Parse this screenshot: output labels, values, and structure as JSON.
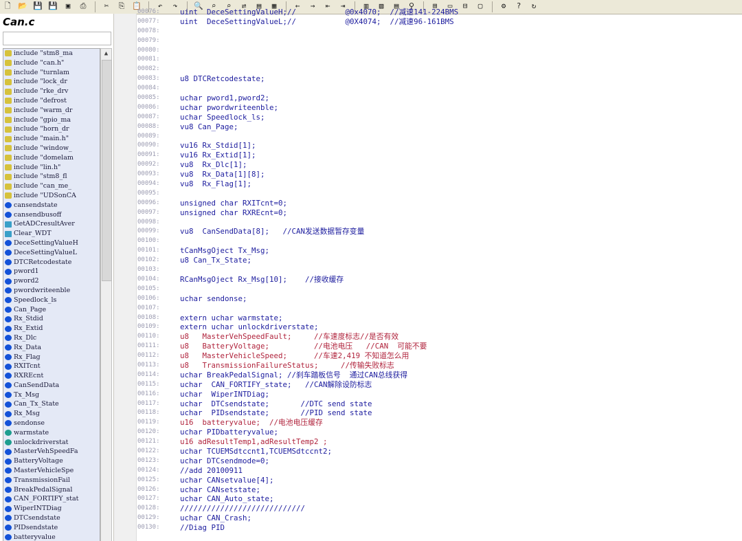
{
  "window": {
    "file_title": "Can.c"
  },
  "toolbar": {
    "buttons": [
      {
        "name": "new-file-icon",
        "glyph": "🗋"
      },
      {
        "name": "open-folder-icon",
        "glyph": "📂"
      },
      {
        "name": "save-icon",
        "glyph": "💾"
      },
      {
        "name": "save-all-icon",
        "glyph": "💾"
      },
      {
        "name": "save-copy-icon",
        "glyph": "▣"
      },
      {
        "name": "print-icon",
        "glyph": "⎙"
      },
      {
        "name": "cut-icon",
        "glyph": "✂"
      },
      {
        "name": "copy-icon",
        "glyph": "⎘"
      },
      {
        "name": "paste-icon",
        "glyph": "📋"
      },
      {
        "name": "undo-icon",
        "glyph": "↶"
      },
      {
        "name": "redo-icon",
        "glyph": "↷"
      },
      {
        "name": "find-icon",
        "glyph": "🔍"
      },
      {
        "name": "find-next-icon",
        "glyph": "⌕"
      },
      {
        "name": "find-prev-icon",
        "glyph": "⌕"
      },
      {
        "name": "replace-icon",
        "glyph": "⇄"
      },
      {
        "name": "bookmark-icon",
        "glyph": "▤"
      },
      {
        "name": "bookmark-clear-icon",
        "glyph": "▦"
      },
      {
        "name": "back-arrow-icon",
        "glyph": "←"
      },
      {
        "name": "forward-arrow-icon",
        "glyph": "→"
      },
      {
        "name": "jump-back-icon",
        "glyph": "⇤"
      },
      {
        "name": "jump-forward-icon",
        "glyph": "⇥"
      },
      {
        "name": "symbol-window-icon",
        "glyph": "▥"
      },
      {
        "name": "relation-window-icon",
        "glyph": "▧"
      },
      {
        "name": "panel-icon",
        "glyph": "▤"
      },
      {
        "name": "lookup-icon",
        "glyph": "⚲"
      },
      {
        "name": "layout-grid-icon",
        "glyph": "⊞"
      },
      {
        "name": "layout-single-icon",
        "glyph": "▭"
      },
      {
        "name": "layout-split-icon",
        "glyph": "⊟"
      },
      {
        "name": "layout-window-icon",
        "glyph": "▢"
      },
      {
        "name": "settings-icon",
        "glyph": "⚙"
      },
      {
        "name": "help-icon",
        "glyph": "?"
      },
      {
        "name": "refresh-icon",
        "glyph": "↻"
      }
    ]
  },
  "symbols": [
    {
      "type": "include",
      "label": "include \"stm8_ma"
    },
    {
      "type": "include",
      "label": "include \"can.h\""
    },
    {
      "type": "include",
      "label": "include \"turnlam"
    },
    {
      "type": "include",
      "label": "include \"lock_dr"
    },
    {
      "type": "include",
      "label": "include \"rke_drv"
    },
    {
      "type": "include",
      "label": "include \"defrost"
    },
    {
      "type": "include",
      "label": "include \"warm_dr"
    },
    {
      "type": "include",
      "label": "include \"gpio_ma"
    },
    {
      "type": "include",
      "label": "include \"horn_dr"
    },
    {
      "type": "include",
      "label": "include \"main.h\""
    },
    {
      "type": "include",
      "label": "include \"window_"
    },
    {
      "type": "include",
      "label": "include \"domelam"
    },
    {
      "type": "include",
      "label": "include \"lin.h\""
    },
    {
      "type": "include",
      "label": "include \"stm8_fl"
    },
    {
      "type": "include",
      "label": "include \"can_me_"
    },
    {
      "type": "include",
      "label": "include \"UDSonCA"
    },
    {
      "type": "var",
      "label": "cansendstate"
    },
    {
      "type": "var",
      "label": "cansendbusoff"
    },
    {
      "type": "func",
      "label": "GetADCresultAver"
    },
    {
      "type": "func",
      "label": "Clear_WDT"
    },
    {
      "type": "var",
      "label": "DeceSettingValueH"
    },
    {
      "type": "var",
      "label": "DeceSettingValueL"
    },
    {
      "type": "var",
      "label": "DTCRetcodestate"
    },
    {
      "type": "var",
      "label": "pword1"
    },
    {
      "type": "var",
      "label": "pword2"
    },
    {
      "type": "var",
      "label": "pwordwriteenble"
    },
    {
      "type": "var",
      "label": "Speedlock_ls"
    },
    {
      "type": "var",
      "label": "Can_Page"
    },
    {
      "type": "var",
      "label": "Rx_Stdid"
    },
    {
      "type": "var",
      "label": "Rx_Extid"
    },
    {
      "type": "var",
      "label": "Rx_Dlc"
    },
    {
      "type": "var",
      "label": "Rx_Data"
    },
    {
      "type": "var",
      "label": "Rx_Flag"
    },
    {
      "type": "var",
      "label": "RXITcnt"
    },
    {
      "type": "var",
      "label": "RXREcnt"
    },
    {
      "type": "var",
      "label": "CanSendData"
    },
    {
      "type": "var",
      "label": "Tx_Msg"
    },
    {
      "type": "var",
      "label": "Can_Tx_State"
    },
    {
      "type": "var",
      "label": "Rx_Msg"
    },
    {
      "type": "var",
      "label": "sendonse"
    },
    {
      "type": "ext",
      "label": "warmstate"
    },
    {
      "type": "ext",
      "label": "unlockdriverstat"
    },
    {
      "type": "var",
      "label": "MasterVehSpeedFa"
    },
    {
      "type": "var",
      "label": "BatteryVoltage"
    },
    {
      "type": "var",
      "label": "MasterVehicleSpe"
    },
    {
      "type": "var",
      "label": "TransmissionFail"
    },
    {
      "type": "var",
      "label": "BreakPedalSignal"
    },
    {
      "type": "var",
      "label": "CAN_FORTIFY_stat"
    },
    {
      "type": "var",
      "label": "WiperINTDiag"
    },
    {
      "type": "var",
      "label": "DTCsendstate"
    },
    {
      "type": "var",
      "label": "PIDsendstate"
    },
    {
      "type": "var",
      "label": "batteryvalue"
    }
  ],
  "code_lines": [
    {
      "num": "00076:",
      "text": "uint  DeceSettingValueH;//           @0x4070;  //减速141-224BMS",
      "style": "normal"
    },
    {
      "num": "00077:",
      "text": "uint  DeceSettingValueL;//           @0X4074;  //减速96-161BMS",
      "style": "normal"
    },
    {
      "num": "00078:",
      "text": "",
      "style": "normal"
    },
    {
      "num": "00079:",
      "text": "",
      "style": "normal"
    },
    {
      "num": "00080:",
      "text": "",
      "style": "normal"
    },
    {
      "num": "00081:",
      "text": "",
      "style": "normal"
    },
    {
      "num": "00082:",
      "text": "",
      "style": "normal"
    },
    {
      "num": "00083:",
      "text": "u8 DTCRetcodestate;",
      "style": "normal"
    },
    {
      "num": "00084:",
      "text": "",
      "style": "normal"
    },
    {
      "num": "00085:",
      "text": "uchar pword1,pword2;",
      "style": "normal"
    },
    {
      "num": "00086:",
      "text": "uchar pwordwriteenble;",
      "style": "normal"
    },
    {
      "num": "00087:",
      "text": "uchar Speedlock_ls;",
      "style": "normal"
    },
    {
      "num": "00088:",
      "text": "vu8 Can_Page;",
      "style": "normal"
    },
    {
      "num": "00089:",
      "text": "",
      "style": "normal"
    },
    {
      "num": "00090:",
      "text": "vu16 Rx_Stdid[1];",
      "style": "normal"
    },
    {
      "num": "00091:",
      "text": "vu16 Rx_Extid[1];",
      "style": "normal"
    },
    {
      "num": "00092:",
      "text": "vu8  Rx_Dlc[1];",
      "style": "normal"
    },
    {
      "num": "00093:",
      "text": "vu8  Rx_Data[1][8];",
      "style": "normal"
    },
    {
      "num": "00094:",
      "text": "vu8  Rx_Flag[1];",
      "style": "normal"
    },
    {
      "num": "00095:",
      "text": "",
      "style": "normal"
    },
    {
      "num": "00096:",
      "text": "unsigned char RXITcnt=0;",
      "style": "normal"
    },
    {
      "num": "00097:",
      "text": "unsigned char RXREcnt=0;",
      "style": "normal"
    },
    {
      "num": "00098:",
      "text": "",
      "style": "normal"
    },
    {
      "num": "00099:",
      "text": "vu8  CanSendData[8];   //CAN发送数据暂存变量",
      "style": "normal"
    },
    {
      "num": "00100:",
      "text": "",
      "style": "normal"
    },
    {
      "num": "00101:",
      "text": "tCanMsgOject Tx_Msg;",
      "style": "normal"
    },
    {
      "num": "00102:",
      "text": "u8 Can_Tx_State;",
      "style": "normal"
    },
    {
      "num": "00103:",
      "text": "",
      "style": "normal"
    },
    {
      "num": "00104:",
      "text": "RCanMsgOject Rx_Msg[10];    //接收缓存",
      "style": "normal"
    },
    {
      "num": "00105:",
      "text": "",
      "style": "normal"
    },
    {
      "num": "00106:",
      "text": "uchar sendonse;",
      "style": "normal"
    },
    {
      "num": "00107:",
      "text": "",
      "style": "normal"
    },
    {
      "num": "00108:",
      "text": "extern uchar warmstate;",
      "style": "normal"
    },
    {
      "num": "00109:",
      "text": "extern uchar unlockdriverstate;",
      "style": "normal"
    },
    {
      "num": "00110:",
      "text": "u8   MasterVehSpeedFault;     //车速度标志//是否有效",
      "style": "red"
    },
    {
      "num": "00111:",
      "text": "u8   BatteryVoltage;          //电池电压   //CAN  可能不要",
      "style": "red"
    },
    {
      "num": "00112:",
      "text": "u8   MasterVehicleSpeed;      //车速2,419 不知道怎么用",
      "style": "red"
    },
    {
      "num": "00113:",
      "text": "u8   TransmissionFailureStatus;     //传输失败标志",
      "style": "red"
    },
    {
      "num": "00114:",
      "text": "uchar BreakPedalSignal; //刹车踏板信号  通过CAN总线获得",
      "style": "normal"
    },
    {
      "num": "00115:",
      "text": "uchar  CAN_FORTIFY_state;   //CAN解除设防标志",
      "style": "normal"
    },
    {
      "num": "00116:",
      "text": "uchar  WiperINTDiag;",
      "style": "normal"
    },
    {
      "num": "00117:",
      "text": "uchar  DTCsendstate;       //DTC send state",
      "style": "normal"
    },
    {
      "num": "00118:",
      "text": "uchar  PIDsendstate;       //PID send state",
      "style": "normal"
    },
    {
      "num": "00119:",
      "text": "u16  batteryvalue;  //电池电压缓存",
      "style": "red"
    },
    {
      "num": "00120:",
      "text": "uchar PIDbatteryvalue;",
      "style": "normal"
    },
    {
      "num": "00121:",
      "text": "u16 adResultTemp1,adResultTemp2 ;",
      "style": "red"
    },
    {
      "num": "00122:",
      "text": "uchar TCUEMSdtccnt1,TCUEMSdtccnt2;",
      "style": "normal"
    },
    {
      "num": "00123:",
      "text": "uchar DTCsendmode=0;",
      "style": "normal"
    },
    {
      "num": "00124:",
      "text": "//add 20100911",
      "style": "normal"
    },
    {
      "num": "00125:",
      "text": "uchar CANsetvalue[4];",
      "style": "normal"
    },
    {
      "num": "00126:",
      "text": "uchar CANsetstate;",
      "style": "normal"
    },
    {
      "num": "00127:",
      "text": "uchar CAN_Auto_state;",
      "style": "normal"
    },
    {
      "num": "00128:",
      "text": "////////////////////////////",
      "style": "normal"
    },
    {
      "num": "00129:",
      "text": "uchar CAN_Crash;",
      "style": "normal"
    },
    {
      "num": "00130:",
      "text": "//Diag PID",
      "style": "normal"
    }
  ]
}
